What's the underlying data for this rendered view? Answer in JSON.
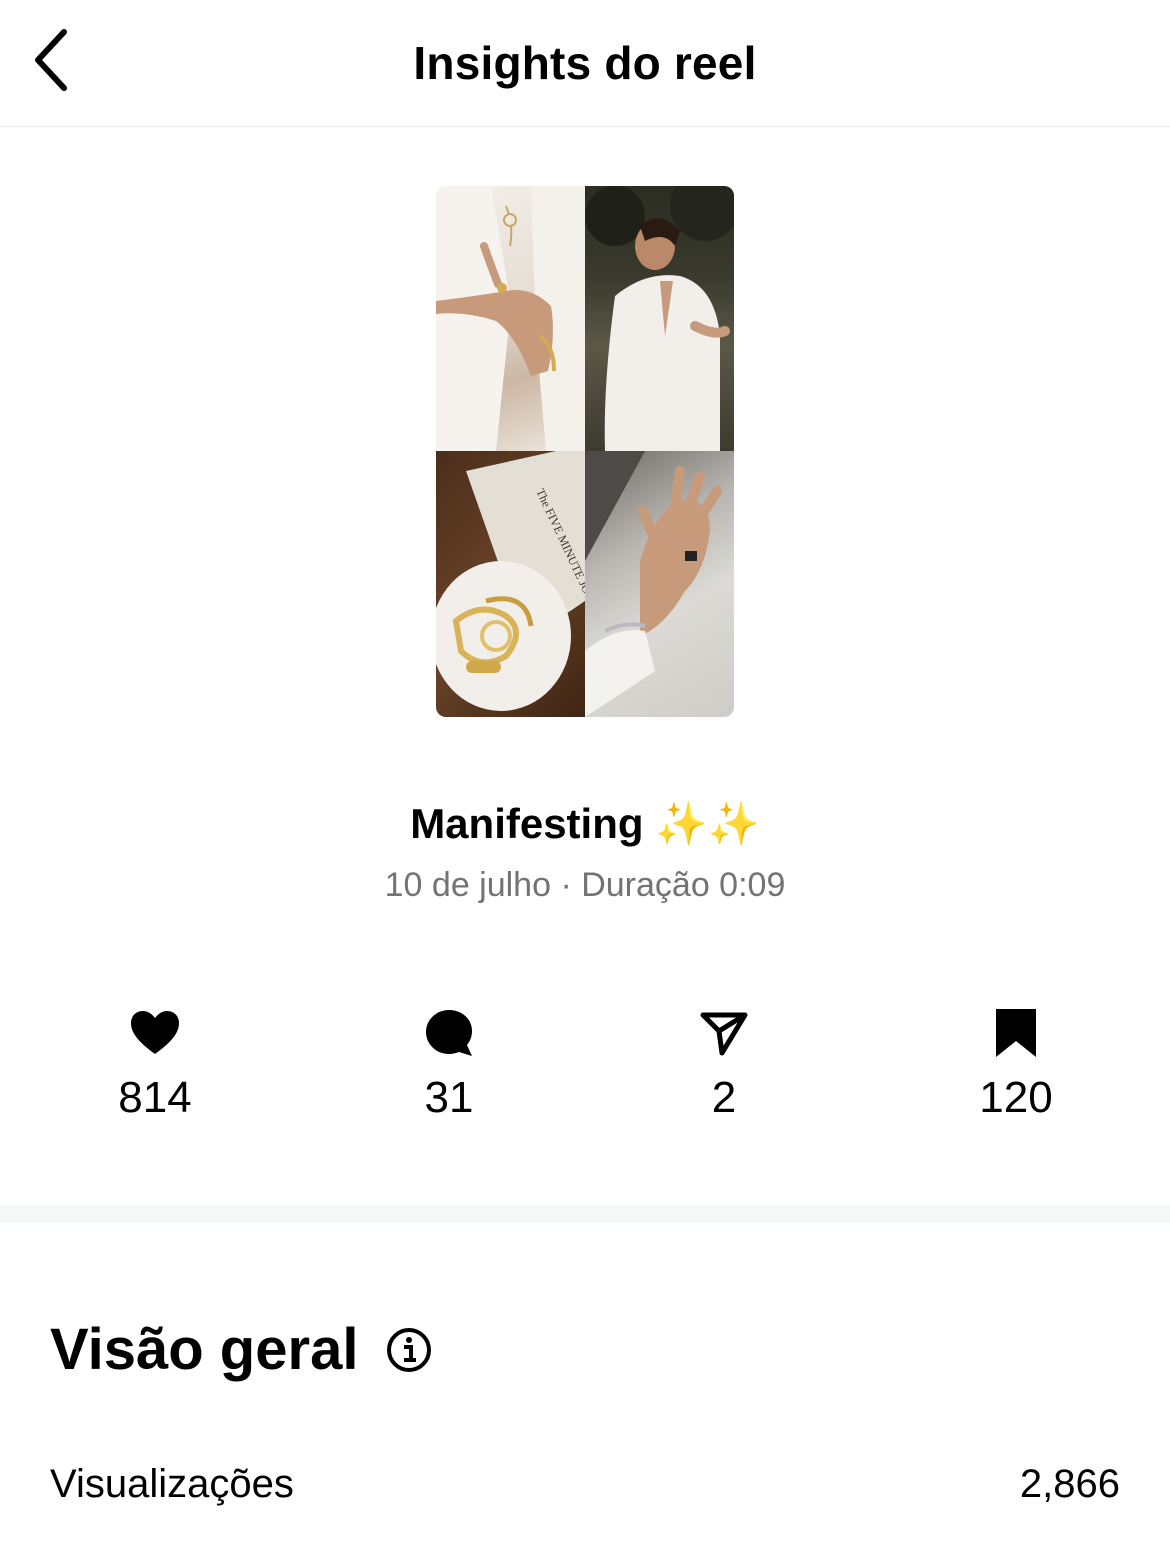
{
  "header": {
    "back_icon": "chevron-left-icon",
    "title": "Insights do reel"
  },
  "reel": {
    "thumbnail": {
      "journal_text": "The FIVE MINUTE JOURNAL"
    },
    "title": "Manifesting ✨✨",
    "meta": "10 de julho · Duração 0:09"
  },
  "stats": [
    {
      "icon": "heart-icon",
      "value": "814"
    },
    {
      "icon": "comment-icon",
      "value": "31"
    },
    {
      "icon": "share-icon",
      "value": "2"
    },
    {
      "icon": "bookmark-icon",
      "value": "120"
    }
  ],
  "overview": {
    "title": "Visão geral",
    "info_icon": "info-icon",
    "rows": [
      {
        "label": "Visualizações",
        "value": "2,866"
      }
    ]
  }
}
